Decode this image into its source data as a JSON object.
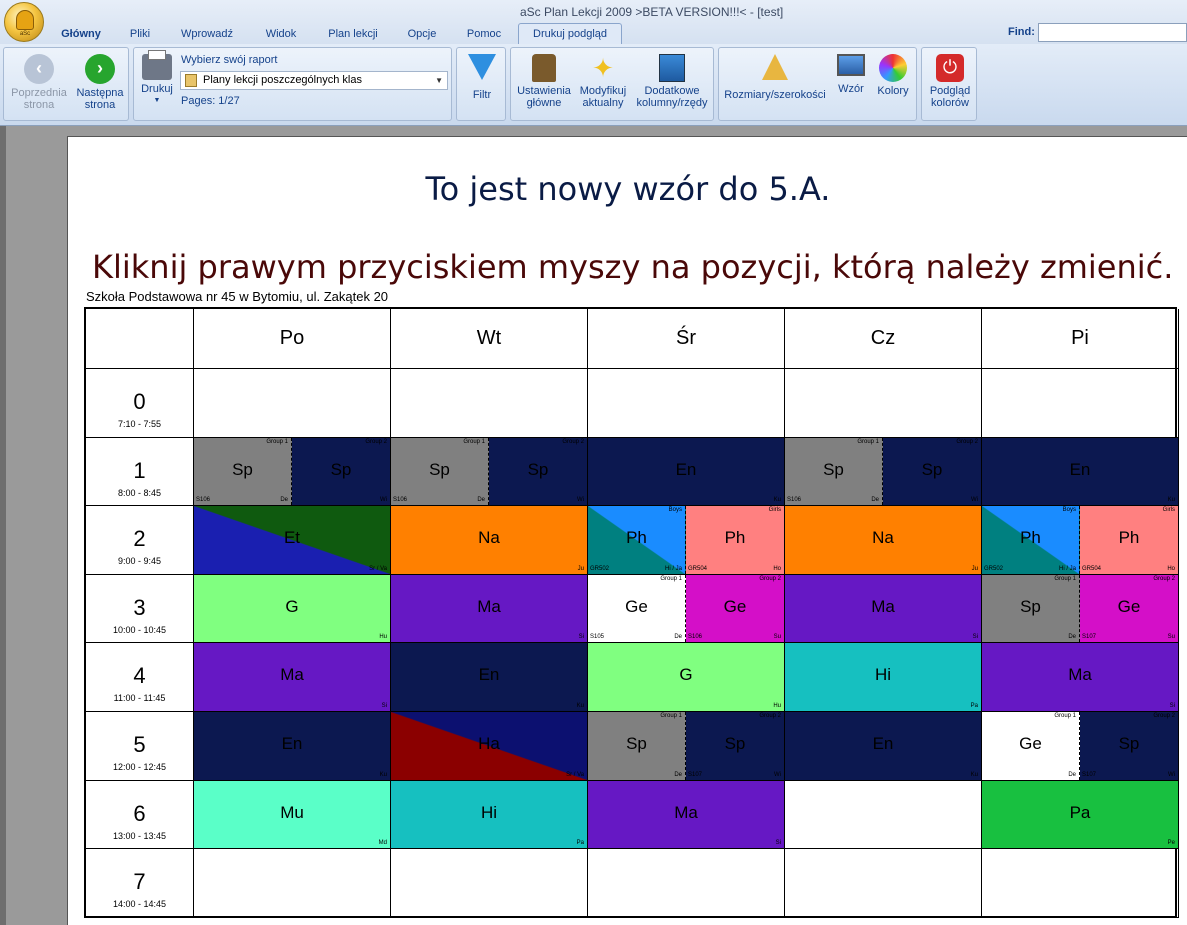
{
  "window": {
    "title": "aSc Plan Lekcji 2009  >BETA VERSION!!!< - [test]",
    "orb_label": "aSc"
  },
  "tabs": [
    "Główny",
    "Pliki",
    "Wprowadź",
    "Widok",
    "Plan lekcji",
    "Opcje",
    "Pomoc",
    "Drukuj podgląd"
  ],
  "find": {
    "label": "Find:",
    "value": ""
  },
  "ribbon": {
    "prev_label": "Poprzednia\nstrona",
    "next_label": "Następna\nstrona",
    "print_label": "Drukuj",
    "report_title": "Wybierz swój raport",
    "report_selected": "Plany lekcji poszczególnych klas",
    "pages": "Pages: 1/27",
    "filter_label": "Filtr",
    "settings_label": "Ustawienia\ngłówne",
    "modify_label": "Modyfikuj\naktualny",
    "extra_label": "Dodatkowe\nkolumny/rzędy",
    "size_label": "Rozmiary/szerokości",
    "template_label": "Wzór",
    "colors_label": "Kolory",
    "preview_colors_label": "Podgląd\nkolorów"
  },
  "page": {
    "title": "To jest nowy wzór do 5.A.",
    "subtitle": "Kliknij prawym przyciskiem myszy na pozycji, którą należy zmienić.",
    "school": "Szkoła Podstawowa nr 45 w Bytomiu,  ul. Zakątek 20"
  },
  "timetable": {
    "days": [
      "Po",
      "Wt",
      "Śr",
      "Cz",
      "Pi"
    ],
    "periods": [
      {
        "num": "0",
        "time": "7:10 - 7:55"
      },
      {
        "num": "1",
        "time": "8:00 - 8:45"
      },
      {
        "num": "2",
        "time": "9:00 - 9:45"
      },
      {
        "num": "3",
        "time": "10:00 - 10:45"
      },
      {
        "num": "4",
        "time": "11:00 - 11:45"
      },
      {
        "num": "5",
        "time": "12:00 - 12:45"
      },
      {
        "num": "6",
        "time": "13:00 - 13:45"
      },
      {
        "num": "7",
        "time": "14:00 - 14:45"
      }
    ],
    "lessons": [
      {
        "p": 1,
        "d": 0,
        "half": "left",
        "subj": "Sp",
        "color": "#808080",
        "text": "#000",
        "tl": "",
        "tr": "Group 1",
        "bl": "S106",
        "br": "De"
      },
      {
        "p": 1,
        "d": 0,
        "half": "right",
        "subj": "Sp",
        "color": "#0c1850",
        "text": "#000",
        "tl": "",
        "tr": "Group 2",
        "bl": "",
        "br": "Wi"
      },
      {
        "p": 1,
        "d": 1,
        "half": "left",
        "subj": "Sp",
        "color": "#808080",
        "text": "#000",
        "tl": "",
        "tr": "Group 1",
        "bl": "S106",
        "br": "De"
      },
      {
        "p": 1,
        "d": 1,
        "half": "right",
        "subj": "Sp",
        "color": "#0c1850",
        "text": "#000",
        "tl": "",
        "tr": "Group 2",
        "bl": "",
        "br": "Wi"
      },
      {
        "p": 1,
        "d": 2,
        "half": "full",
        "subj": "En",
        "color": "#0c1850",
        "text": "#000",
        "tl": "",
        "tr": "",
        "bl": "",
        "br": "Ku"
      },
      {
        "p": 1,
        "d": 3,
        "half": "left",
        "subj": "Sp",
        "color": "#808080",
        "text": "#000",
        "tl": "",
        "tr": "Group 1",
        "bl": "S106",
        "br": "De"
      },
      {
        "p": 1,
        "d": 3,
        "half": "right",
        "subj": "Sp",
        "color": "#0c1850",
        "text": "#000",
        "tl": "",
        "tr": "Group 2",
        "bl": "",
        "br": "Wi"
      },
      {
        "p": 1,
        "d": 4,
        "half": "full",
        "subj": "En",
        "color": "#0c1850",
        "text": "#000",
        "tl": "",
        "tr": "",
        "bl": "",
        "br": "Ku"
      },
      {
        "p": 2,
        "d": 0,
        "half": "full",
        "subj": "Et",
        "color": "#1a1fb0",
        "color2": "#0f5a0f",
        "text": "#000",
        "tl": "",
        "tr": "",
        "bl": "",
        "br": "Sr / Va"
      },
      {
        "p": 2,
        "d": 1,
        "half": "full",
        "subj": "Na",
        "color": "#ff8000",
        "text": "#000",
        "tl": "",
        "tr": "",
        "bl": "",
        "br": "Ju"
      },
      {
        "p": 2,
        "d": 2,
        "half": "left",
        "subj": "Ph",
        "color": "#008080",
        "color2": "#1a8cff",
        "text": "#000",
        "tl": "",
        "tr": "Boys",
        "bl": "GR502",
        "br": "Hi / Ja"
      },
      {
        "p": 2,
        "d": 2,
        "half": "right",
        "subj": "Ph",
        "color": "#ff8080",
        "text": "#000",
        "tl": "",
        "tr": "Girls",
        "bl": "GR504",
        "br": "Ho"
      },
      {
        "p": 2,
        "d": 3,
        "half": "full",
        "subj": "Na",
        "color": "#ff8000",
        "text": "#000",
        "tl": "",
        "tr": "",
        "bl": "",
        "br": "Ju"
      },
      {
        "p": 2,
        "d": 4,
        "half": "left",
        "subj": "Ph",
        "color": "#008080",
        "color2": "#1a8cff",
        "text": "#000",
        "tl": "",
        "tr": "Boys",
        "bl": "GR502",
        "br": "Hi / Ja"
      },
      {
        "p": 2,
        "d": 4,
        "half": "right",
        "subj": "Ph",
        "color": "#ff8080",
        "text": "#000",
        "tl": "",
        "tr": "Girls",
        "bl": "GR504",
        "br": "Ho"
      },
      {
        "p": 3,
        "d": 0,
        "half": "full",
        "subj": "G",
        "color": "#80ff80",
        "text": "#000",
        "tl": "",
        "tr": "",
        "bl": "",
        "br": "Hu"
      },
      {
        "p": 3,
        "d": 1,
        "half": "full",
        "subj": "Ma",
        "color": "#6618c4",
        "text": "#000",
        "tl": "",
        "tr": "",
        "bl": "",
        "br": "Si"
      },
      {
        "p": 3,
        "d": 2,
        "half": "left",
        "subj": "Ge",
        "color": "#ffffff",
        "text": "#000",
        "tl": "",
        "tr": "Group 1",
        "bl": "S105",
        "br": "De"
      },
      {
        "p": 3,
        "d": 2,
        "half": "right",
        "subj": "Ge",
        "color": "#d40fc8",
        "text": "#000",
        "tl": "",
        "tr": "Group 2",
        "bl": "S106",
        "br": "Su"
      },
      {
        "p": 3,
        "d": 3,
        "half": "full",
        "subj": "Ma",
        "color": "#6618c4",
        "text": "#000",
        "tl": "",
        "tr": "",
        "bl": "",
        "br": "Si"
      },
      {
        "p": 3,
        "d": 4,
        "half": "left",
        "subj": "Sp",
        "color": "#808080",
        "text": "#000",
        "tl": "",
        "tr": "Group 1",
        "bl": "",
        "br": "De"
      },
      {
        "p": 3,
        "d": 4,
        "half": "right",
        "subj": "Ge",
        "color": "#d40fc8",
        "text": "#000",
        "tl": "",
        "tr": "Group 2",
        "bl": "S107",
        "br": "Su"
      },
      {
        "p": 4,
        "d": 0,
        "half": "full",
        "subj": "Ma",
        "color": "#6618c4",
        "text": "#000",
        "tl": "",
        "tr": "",
        "bl": "",
        "br": "Si"
      },
      {
        "p": 4,
        "d": 1,
        "half": "full",
        "subj": "En",
        "color": "#0c1850",
        "text": "#000",
        "tl": "",
        "tr": "",
        "bl": "",
        "br": "Ku"
      },
      {
        "p": 4,
        "d": 2,
        "half": "full",
        "subj": "G",
        "color": "#80ff80",
        "text": "#000",
        "tl": "",
        "tr": "",
        "bl": "",
        "br": "Hu"
      },
      {
        "p": 4,
        "d": 3,
        "half": "full",
        "subj": "Hi",
        "color": "#16c0c0",
        "text": "#000",
        "tl": "",
        "tr": "",
        "bl": "",
        "br": "Pa"
      },
      {
        "p": 4,
        "d": 4,
        "half": "full",
        "subj": "Ma",
        "color": "#6618c4",
        "text": "#000",
        "tl": "",
        "tr": "",
        "bl": "",
        "br": "Si"
      },
      {
        "p": 5,
        "d": 0,
        "half": "full",
        "subj": "En",
        "color": "#0c1850",
        "text": "#000",
        "tl": "",
        "tr": "",
        "bl": "",
        "br": "Ku"
      },
      {
        "p": 5,
        "d": 1,
        "half": "full",
        "subj": "Ha",
        "color": "#8b0000",
        "color2": "#0c1070",
        "text": "#000",
        "tl": "",
        "tr": "",
        "bl": "",
        "br": "Sr / Va"
      },
      {
        "p": 5,
        "d": 2,
        "half": "left",
        "subj": "Sp",
        "color": "#808080",
        "text": "#000",
        "tl": "",
        "tr": "Group 1",
        "bl": "",
        "br": "De"
      },
      {
        "p": 5,
        "d": 2,
        "half": "right",
        "subj": "Sp",
        "color": "#0c1850",
        "text": "#000",
        "tl": "",
        "tr": "Group 2",
        "bl": "S107",
        "br": "Wi"
      },
      {
        "p": 5,
        "d": 3,
        "half": "full",
        "subj": "En",
        "color": "#0c1850",
        "text": "#000",
        "tl": "",
        "tr": "",
        "bl": "",
        "br": "Ku"
      },
      {
        "p": 5,
        "d": 4,
        "half": "left",
        "subj": "Ge",
        "color": "#ffffff",
        "text": "#000",
        "tl": "",
        "tr": "Group 1",
        "bl": "",
        "br": "De"
      },
      {
        "p": 5,
        "d": 4,
        "half": "right",
        "subj": "Sp",
        "color": "#0c1850",
        "text": "#000",
        "tl": "",
        "tr": "Group 2",
        "bl": "S107",
        "br": "Wi"
      },
      {
        "p": 6,
        "d": 0,
        "half": "full",
        "subj": "Mu",
        "color": "#5affc8",
        "text": "#000",
        "tl": "",
        "tr": "",
        "bl": "",
        "br": "Md"
      },
      {
        "p": 6,
        "d": 1,
        "half": "full",
        "subj": "Hi",
        "color": "#16c0c0",
        "text": "#000",
        "tl": "",
        "tr": "",
        "bl": "",
        "br": "Pa"
      },
      {
        "p": 6,
        "d": 2,
        "half": "full",
        "subj": "Ma",
        "color": "#6618c4",
        "text": "#000",
        "tl": "",
        "tr": "",
        "bl": "",
        "br": "Si"
      },
      {
        "p": 6,
        "d": 4,
        "half": "full",
        "subj": "Pa",
        "color": "#18c040",
        "text": "#000",
        "tl": "",
        "tr": "",
        "bl": "",
        "br": "Pe"
      }
    ]
  }
}
